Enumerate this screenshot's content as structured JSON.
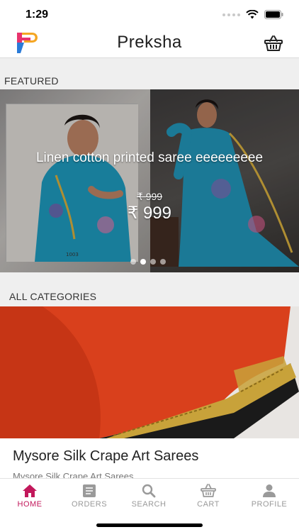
{
  "status": {
    "time": "1:29"
  },
  "header": {
    "title": "Preksha",
    "cart_icon": "basket-icon"
  },
  "featured": {
    "label": "FEATURED",
    "banner": {
      "title": "Linen cotton printed saree eeeeeeeee",
      "old_price": "₹ 999",
      "price": "₹ 999",
      "image_caption": "1003",
      "slide_count": 4,
      "active_slide": 1
    }
  },
  "categories": {
    "label": "ALL CATEGORIES",
    "items": [
      {
        "title": "Mysore Silk Crape Art Sarees",
        "subtitle": "Mysore Silk Crape Art Sarees"
      }
    ]
  },
  "nav": {
    "items": [
      {
        "label": "HOME",
        "icon": "home-icon",
        "active": true
      },
      {
        "label": "ORDERS",
        "icon": "orders-icon",
        "active": false
      },
      {
        "label": "SEARCH",
        "icon": "search-icon",
        "active": false
      },
      {
        "label": "CART",
        "icon": "basket-icon",
        "active": false
      },
      {
        "label": "PROFILE",
        "icon": "profile-icon",
        "active": false
      }
    ]
  },
  "colors": {
    "accent": "#c2185b",
    "logo_pink": "#e8336d",
    "logo_orange": "#f5a623",
    "logo_blue": "#2a7bd8",
    "saree_blue": "#1c8fb0",
    "saree_orange": "#d9401c",
    "saree_gold": "#c8a23a"
  }
}
